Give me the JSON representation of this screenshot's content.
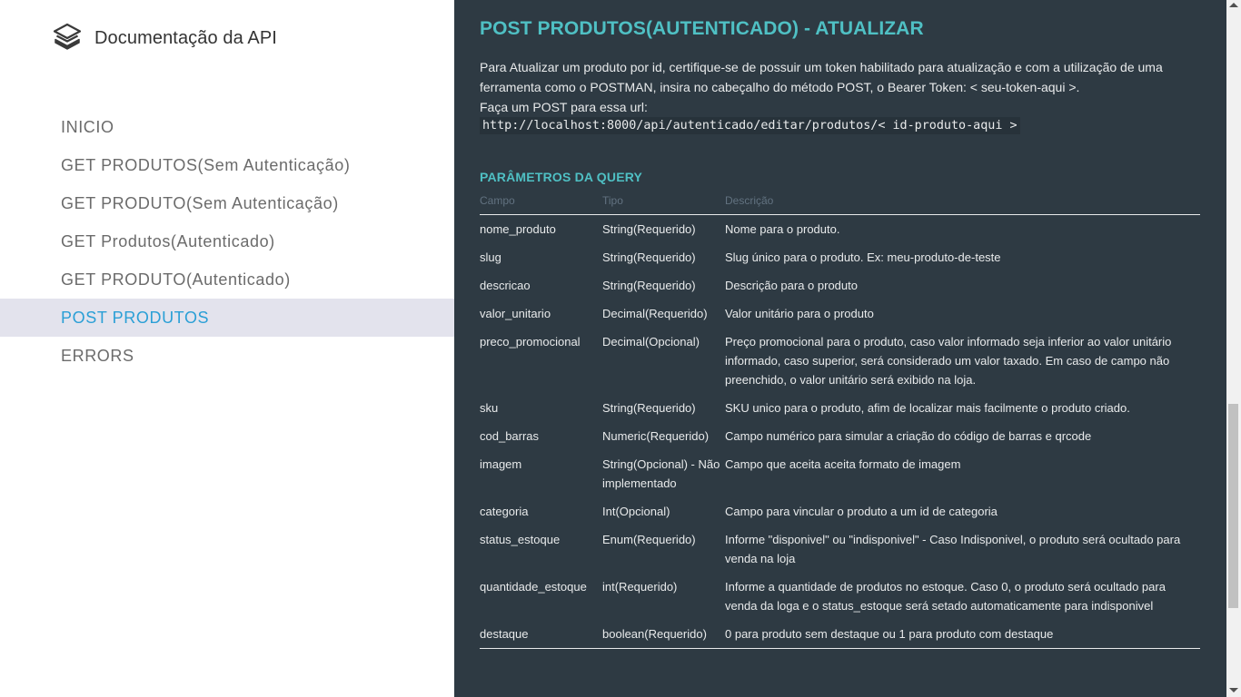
{
  "sidebar": {
    "brand_title": "Documentação da API",
    "items": [
      {
        "label": "INICIO"
      },
      {
        "label": "GET PRODUTOS(Sem Autenticação)"
      },
      {
        "label": "GET PRODUTO(Sem Autenticação)"
      },
      {
        "label": "GET Produtos(Autenticado)"
      },
      {
        "label": "GET PRODUTO(Autenticado)"
      },
      {
        "label": "POST PRODUTOS"
      },
      {
        "label": "ERRORS"
      }
    ]
  },
  "main": {
    "title": "POST PRODUTOS(AUTENTICADO) - ATUALIZAR",
    "intro_line1": "Para Atualizar um produto por id, certifique-se de possuir um token habilitado para atualização e com a utilização de uma ferramenta como o POSTMAN, insira no cabeçalho do método POST, o Bearer Token: < seu-token-aqui >.",
    "intro_line2": "Faça um POST para essa url:",
    "url": "http://localhost:8000/api/autenticado/editar/produtos/< id-produto-aqui >",
    "params_title": "PARÂMETROS DA QUERY",
    "table": {
      "headers": [
        "Campo",
        "Tipo",
        "Descrição"
      ],
      "rows": [
        {
          "campo": "nome_produto",
          "tipo": "String(Requerido)",
          "descricao": "Nome para o produto."
        },
        {
          "campo": "slug",
          "tipo": "String(Requerido)",
          "descricao": "Slug único para o produto. Ex: meu-produto-de-teste"
        },
        {
          "campo": "descricao",
          "tipo": "String(Requerido)",
          "descricao": "Descrição para o produto"
        },
        {
          "campo": "valor_unitario",
          "tipo": "Decimal(Requerido)",
          "descricao": "Valor unitário para o produto"
        },
        {
          "campo": "preco_promocional",
          "tipo": "Decimal(Opcional)",
          "descricao": "Preço promocional para o produto, caso valor informado seja inferior ao valor unitário informado, caso superior, será considerado um valor taxado. Em caso de campo não preenchido, o valor unitário será exibido na loja."
        },
        {
          "campo": "sku",
          "tipo": "String(Requerido)",
          "descricao": "SKU unico para o produto, afim de localizar mais facilmente o produto criado."
        },
        {
          "campo": "cod_barras",
          "tipo": "Numeric(Requerido)",
          "descricao": "Campo numérico para simular a criação do código de barras e qrcode"
        },
        {
          "campo": "imagem",
          "tipo": "String(Opcional) - Não implementado",
          "descricao": "Campo que aceita aceita formato de imagem"
        },
        {
          "campo": "categoria",
          "tipo": "Int(Opcional)",
          "descricao": "Campo para vincular o produto a um id de categoria"
        },
        {
          "campo": "status_estoque",
          "tipo": "Enum(Requerido)",
          "descricao": "Informe \"disponivel\" ou \"indisponivel\" - Caso Indisponivel, o produto será ocultado para venda na loja"
        },
        {
          "campo": "quantidade_estoque",
          "tipo": "int(Requerido)",
          "descricao": "Informe a quantidade de produtos no estoque. Caso 0, o produto será ocultado para venda da loga e o status_estoque será setado automaticamente para indisponivel"
        },
        {
          "campo": "destaque",
          "tipo": "boolean(Requerido)",
          "descricao": "0 para produto sem destaque ou 1 para produto com destaque"
        }
      ]
    }
  },
  "icons": {
    "brand": "layers-icon",
    "scroll_up": "arrow-up-icon",
    "scroll_down": "arrow-down-icon"
  },
  "colors": {
    "sidebar_bg": "#ffffff",
    "active_item_bg": "#e3e3ed",
    "active_item_text": "#2a9fd6",
    "content_bg": "#2e3a43",
    "accent": "#4fc0c4"
  }
}
